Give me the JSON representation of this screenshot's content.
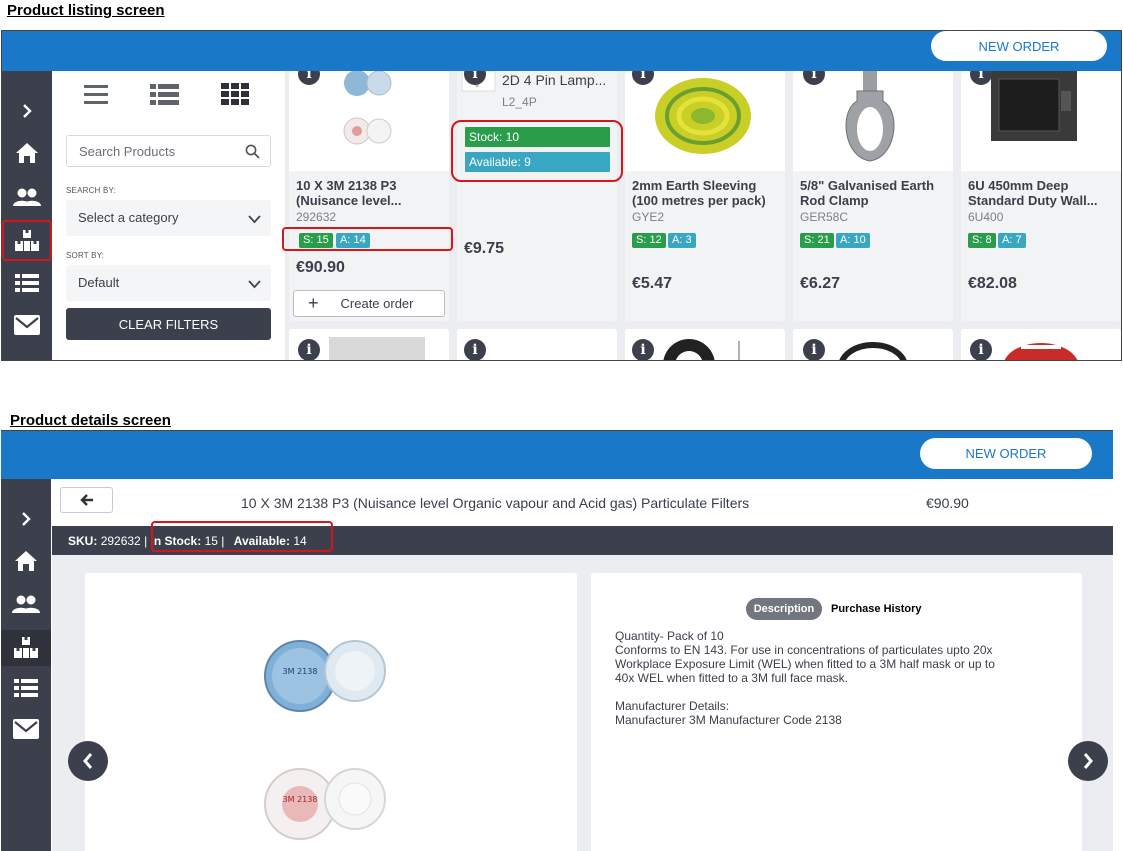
{
  "captions": {
    "listing": "Product listing screen",
    "details": "Product details screen"
  },
  "header": {
    "new_order_label": "NEW ORDER"
  },
  "sidebar": {
    "icons": [
      "chevron-right-icon",
      "home-icon",
      "users-icon",
      "products-icon",
      "list-icon",
      "mail-icon"
    ],
    "active": "products-icon"
  },
  "filters": {
    "search_placeholder": "Search Products",
    "search_by_label": "SEARCH BY:",
    "category_value": "Select a category",
    "sort_by_label": "SORT BY:",
    "sort_value": "Default",
    "clear_label": "CLEAR FILTERS"
  },
  "products": [
    {
      "name_line1": "10 X 3M 2138 P3",
      "name_line2": "(Nuisance level...",
      "code": "292632",
      "stock": "S: 15",
      "available": "A: 14",
      "price": "€90.90",
      "create_label": "Create order"
    },
    {
      "name_line1": "2D 4 Pin Lamp...",
      "code": "L2_4P",
      "stock_full": "Stock: 10",
      "available_full": "Available: 9",
      "price": "€9.75"
    },
    {
      "name_line1": "2mm Earth Sleeving",
      "name_line2": "(100 metres per pack)",
      "code": "GYE2",
      "stock": "S: 12",
      "available": "A: 3",
      "price": "€5.47"
    },
    {
      "name_line1": "5/8\" Galvanised Earth",
      "name_line2": "Rod Clamp",
      "code": "GER58C",
      "stock": "S: 21",
      "available": "A: 10",
      "price": "€6.27"
    },
    {
      "name_line1": "6U 450mm Deep",
      "name_line2": "Standard Duty Wall...",
      "code": "6U400",
      "stock": "S: 8",
      "available": "A: 7",
      "price": "€82.08"
    }
  ],
  "details": {
    "title": "10 X 3M 2138 P3 (Nuisance level Organic vapour and Acid gas) Particulate Filters",
    "price": "€90.90",
    "sku_label": "SKU:",
    "sku_value": "292632",
    "sep": "|",
    "in_stock_label": "In Stock:",
    "in_stock_value": "15",
    "available_label": "Available:",
    "available_value": "14",
    "tab_description": "Description",
    "tab_history": "Purchase History",
    "description": "Quantity- Pack of 10\nConforms to EN 143. For use in concentrations of particulates upto 20x\nWorkplace Exposure Limit (WEL) when fitted to a 3M half mask or up to\n40x WEL when fitted to a 3M full face mask.\n\nManufacturer Details:\nManufacturer 3M Manufacturer Code 2138",
    "filter_print_top": "3M 2138",
    "filter_print_bottom": "3M 2138"
  },
  "colors": {
    "brand_blue": "#1a78c8",
    "sidebar_dark": "#3c404c",
    "stock_green": "#2a9d4a",
    "available_teal": "#3aa7c2",
    "highlight_red": "#d9151c"
  }
}
